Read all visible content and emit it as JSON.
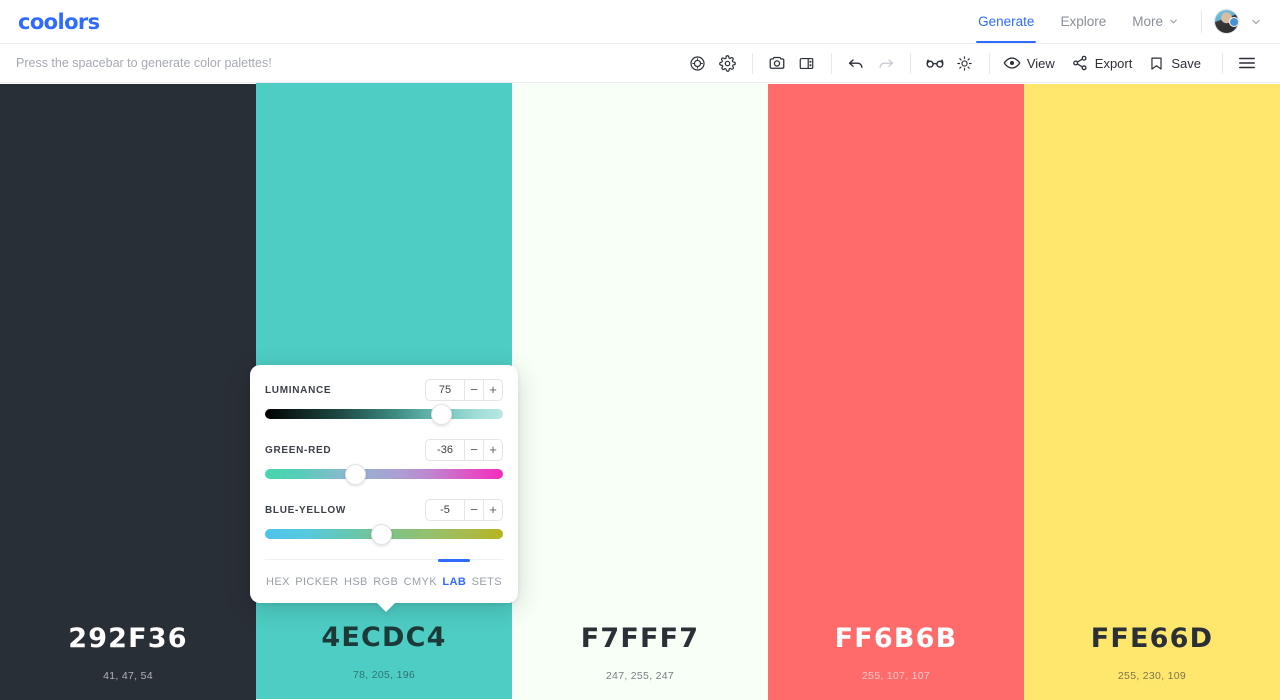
{
  "app": {
    "brand": "coolors"
  },
  "topnav": {
    "links": [
      {
        "label": "Generate",
        "active": true
      },
      {
        "label": "Explore",
        "active": false
      },
      {
        "label": "More",
        "active": false,
        "caret": true
      }
    ],
    "avatar_name": "user-avatar",
    "accent_color": "#2f6bff"
  },
  "toolbar": {
    "hint": "Press the spacebar to generate color palettes!",
    "icons": [
      {
        "name": "contrast-checker-icon",
        "title": "Contrast checker"
      },
      {
        "name": "gear-icon",
        "title": "Settings"
      },
      {
        "name": "camera-icon",
        "title": "Photo"
      },
      {
        "name": "layout-icon",
        "title": "Image picker"
      },
      {
        "name": "undo-icon",
        "title": "Undo",
        "disabled": false
      },
      {
        "name": "redo-icon",
        "title": "Redo",
        "disabled": true
      },
      {
        "name": "glasses-icon",
        "title": "Color blindness"
      },
      {
        "name": "brightness-icon",
        "title": "Adjust"
      }
    ],
    "actions": [
      {
        "label": "View",
        "icon": "eye-icon"
      },
      {
        "label": "Export",
        "icon": "share-icon"
      },
      {
        "label": "Save",
        "icon": "bookmark-icon"
      }
    ],
    "menu_icon": "hamburger-menu-icon"
  },
  "palette": {
    "swatches": [
      {
        "hex": "292F36",
        "rgb": "41, 47, 54",
        "bg": "#292F36",
        "text": "#ffffff",
        "selected": false
      },
      {
        "hex": "4ECDC4",
        "rgb": "78, 205, 196",
        "bg": "#4ECDC4",
        "text": "#1c3b38",
        "selected": true
      },
      {
        "hex": "F7FFF7",
        "rgb": "247, 255, 247",
        "bg": "#F7FFF7",
        "text": "#2b2f36",
        "selected": false
      },
      {
        "hex": "FF6B6B",
        "rgb": "255, 107, 107",
        "bg": "#FF6B6B",
        "text": "#ffffff",
        "selected": false
      },
      {
        "hex": "FFE66D",
        "rgb": "255, 230, 109",
        "bg": "#FFE66D",
        "text": "#2b2f36",
        "selected": false
      }
    ]
  },
  "popup": {
    "controls": [
      {
        "label": "LUMINANCE",
        "value": "75",
        "minus": "−",
        "plus": "+",
        "thumb_pct": 74,
        "gradient": "linear-gradient(90deg, #000000 0%, #0d1f1d 12%, #1f4a45 32%, #3e8b82 55%, #6fc3ba 74%, #9fdcd6 88%, #b8e7e2 100%)"
      },
      {
        "label": "GREEN-RED",
        "value": "-36",
        "minus": "−",
        "plus": "+",
        "thumb_pct": 38,
        "gradient": "linear-gradient(90deg, #46d6ad 0%, #55cdb8 14%, #7bbfc9 28%, #9aaed1 42%, #ab9fd2 56%, #c084cf 70%, #de54c6 86%, #f52bbd 100%)"
      },
      {
        "label": "BLUE-YELLOW",
        "value": "-5",
        "minus": "−",
        "plus": "+",
        "thumb_pct": 49,
        "gradient": "linear-gradient(90deg, #4ec3ec 0%, #55c9df 16%, #63c7b5 34%, #7ec388 52%, #95bf6c 70%, #a9ba4a 86%, #b5b41c 100%)"
      }
    ],
    "tabs": [
      {
        "label": "HEX",
        "active": false
      },
      {
        "label": "PICKER",
        "active": false
      },
      {
        "label": "HSB",
        "active": false
      },
      {
        "label": "RGB",
        "active": false
      },
      {
        "label": "CMYK",
        "active": false
      },
      {
        "label": "LAB",
        "active": true
      },
      {
        "label": "SETS",
        "active": false
      }
    ]
  }
}
